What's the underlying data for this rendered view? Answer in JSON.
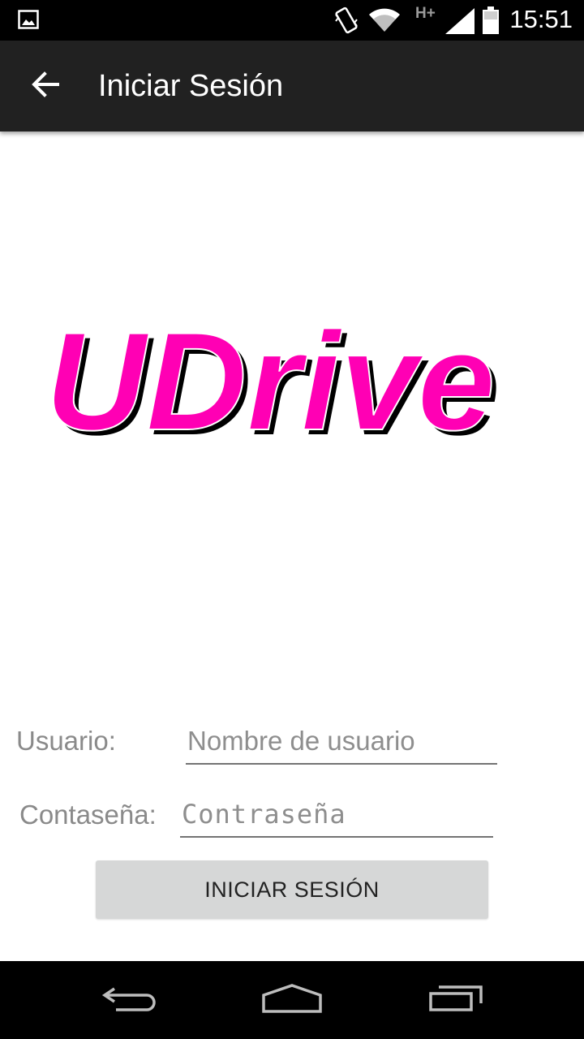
{
  "status_bar": {
    "time": "15:51",
    "network_type": "H+",
    "icons": [
      "image-notification-icon",
      "vibrate-icon",
      "wifi-icon",
      "signal-icon",
      "battery-icon"
    ]
  },
  "toolbar": {
    "title": "Iniciar Sesión",
    "back_icon": "arrow-back-icon"
  },
  "logo": {
    "text": "UDrive",
    "color": "#ff00b4",
    "shadow_color": "#000000"
  },
  "form": {
    "username_label": "Usuario:",
    "username_placeholder": "Nombre de usuario",
    "username_value": "",
    "password_label": "Contaseña:",
    "password_placeholder": "Contraseña",
    "password_value": "",
    "submit_label": "INICIAR SESIÓN"
  },
  "nav_bar": {
    "icons": [
      "nav-back-icon",
      "nav-home-icon",
      "nav-recents-icon"
    ]
  },
  "colors": {
    "status_bar_bg": "#000000",
    "toolbar_bg": "#212121",
    "button_bg": "#d6d7d7",
    "accent": "#ff00b4"
  }
}
